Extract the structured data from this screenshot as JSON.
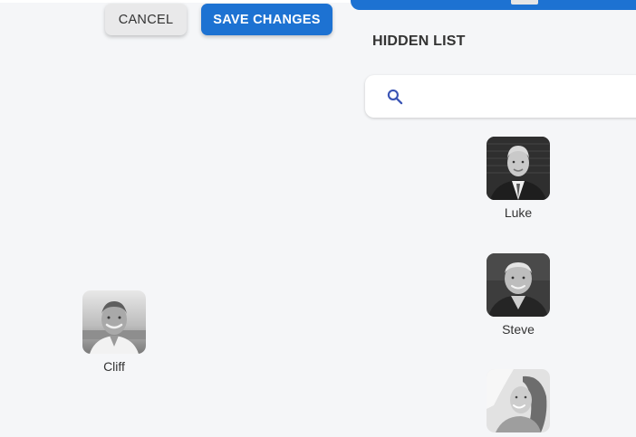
{
  "actions": {
    "cancel_label": "CANCEL",
    "save_label": "SAVE CHANGES"
  },
  "hidden_list": {
    "title": "HIDDEN LIST",
    "search_placeholder": "",
    "people": [
      {
        "name": "Luke"
      },
      {
        "name": "Steve"
      },
      {
        "name": ""
      }
    ]
  },
  "visible_people": [
    {
      "name": "Cliff"
    }
  ],
  "colors": {
    "accent": "#1d72d2",
    "background": "#f5f6f8",
    "search_icon": "#3b55b5"
  },
  "icons": {
    "search": "search-icon"
  }
}
